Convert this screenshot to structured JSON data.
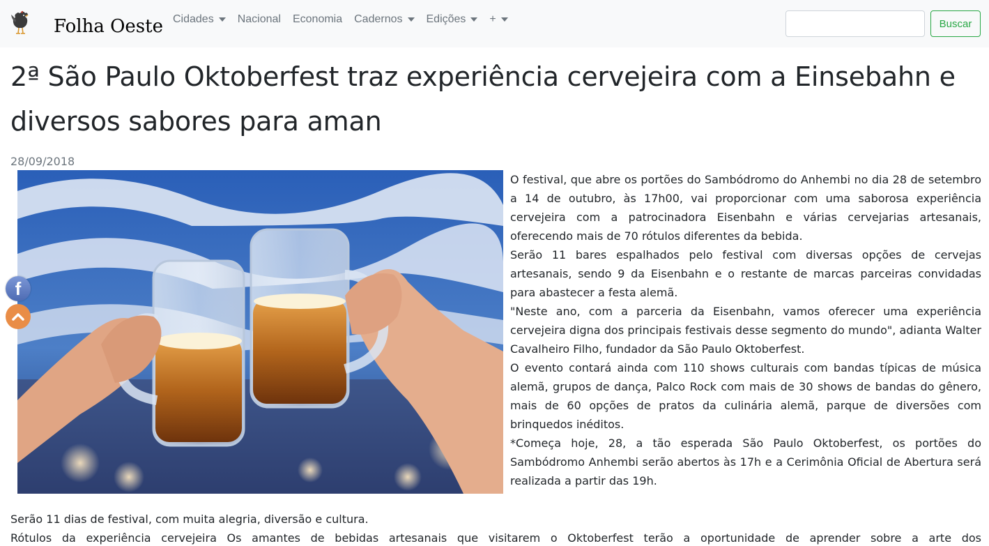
{
  "brand": {
    "name": "Folha Oeste",
    "logo_icon": "rooster-icon"
  },
  "nav": {
    "items": [
      {
        "label": "Cidades",
        "dropdown": true
      },
      {
        "label": "Nacional",
        "dropdown": false
      },
      {
        "label": "Economia",
        "dropdown": false
      },
      {
        "label": "Cadernos",
        "dropdown": true
      },
      {
        "label": "Edições",
        "dropdown": true
      },
      {
        "label": "+",
        "dropdown": true
      }
    ],
    "search_value": "",
    "search_button": "Buscar"
  },
  "article": {
    "title": "2ª São Paulo Oktoberfest traz experiência cervejeira com a Einsebahn e diversos sabores para aman",
    "date": "28/09/2018",
    "image_alt": "Duas canecas de cerveja brindando",
    "paragraphs": [
      "O festival, que abre os portões do Sambódromo do Anhembi no dia 28 de setembro a 14 de outubro, às 17h00, vai proporcionar com uma saborosa experiência cervejeira com a patrocinadora Eisenbahn e várias cervejarias artesanais, oferecendo mais de 70 rótulos diferentes da bebida.",
      "Serão 11 bares espalhados pelo festival com diversas opções de cervejas artesanais, sendo 9 da Eisenbahn e o restante de marcas parceiras convidadas para abastecer a festa alemã.",
      "\"Neste ano, com a parceria da Eisenbahn, vamos oferecer uma experiência cervejeira digna dos principais festivais desse segmento do mundo\", adianta Walter Cavalheiro Filho, fundador da São Paulo Oktoberfest.",
      "O evento contará ainda com 110 shows culturais com bandas típicas de música alemã, grupos de dança, Palco Rock com mais de 30 shows de bandas do gênero, mais de 60 opções de pratos da culinária alemã, parque de diversões com brinquedos inéditos.",
      "*Começa hoje, 28, a tão esperada São Paulo Oktoberfest, os portões do Sambódromo Anhembi serão abertos às 17h e a Cerimônia Oficial de Abertura será realizada a partir das 19h."
    ],
    "bottom_paragraphs": [
      "Serão 11 dias de festival, com muita alegria, diversão e cultura.",
      "Rótulos da experiência cervejeira Os amantes de bebidas artesanais que visitarem o Oktoberfest terão a oportunidade de aprender sobre a arte dos"
    ]
  },
  "floating": {
    "facebook_icon": "facebook-icon",
    "top_icon": "chevron-up-icon"
  },
  "colors": {
    "navbar_bg": "#f8f9fa",
    "search_button": "#28a745",
    "facebook": "#4d6bb3",
    "back_to_top": "#e98d47"
  }
}
